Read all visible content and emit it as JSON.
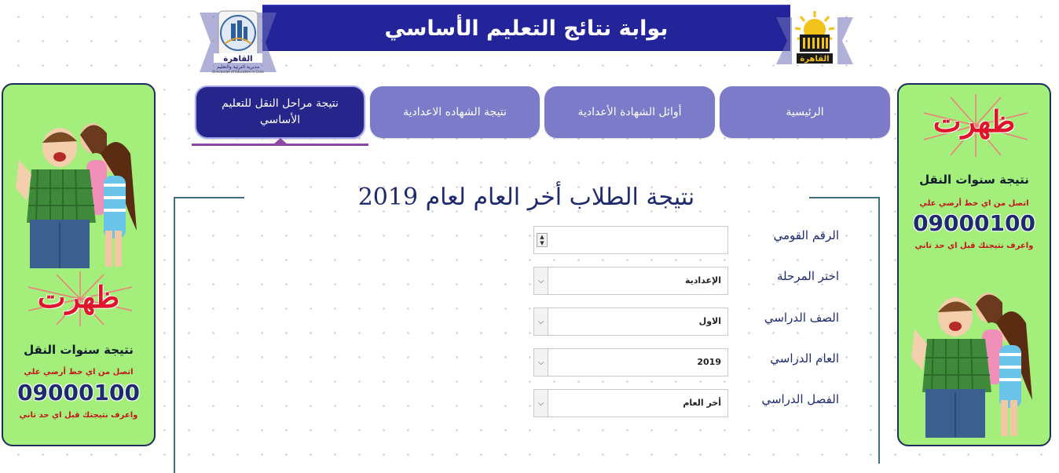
{
  "header": {
    "title": "بوابة نتائج التعليم الأساسي",
    "logo_left_text": "القاهرة",
    "logo_left_subtext": "مديرية التربية والتعليم",
    "logo_left_caption": "Directorate of Education in Cairo",
    "logo_right_text": "القاهرة"
  },
  "nav": {
    "items": [
      {
        "label": "الرئيسية"
      },
      {
        "label": "أوائل الشهادة الأعدادية"
      },
      {
        "label": "نتيجة الشهاده الاعدادية"
      },
      {
        "label": "نتيجة مراحل النقل للتعليم الأساسي"
      }
    ],
    "active_index": 3
  },
  "ads": {
    "headline": "ظهرت",
    "subtitle": "نتيجة سنوات النقل",
    "call_line": "اتصل من اي خط أرضي علي",
    "phone": "09000100",
    "footer_line": "واعرف نتيجتك قبل اي حد تاني"
  },
  "form": {
    "title": "نتيجة الطلاب أخر العام لعام 2019",
    "national_id_label": "الرقم القومي",
    "national_id_value": "",
    "stage_label": "اختر المرحلة",
    "stage_value": "الإعدادية",
    "grade_label": "الصف الدراسي",
    "grade_value": "الاول",
    "year_label": "العام الدراسي",
    "year_value": "2019",
    "term_label": "الفصل الدراسي",
    "term_value": "أخر العام"
  },
  "colors": {
    "header_bg": "#24249a",
    "nav_bg": "#7b7bc9",
    "nav_active_bg": "#25258c",
    "ad_bg": "#a4ee7b",
    "accent_red": "#e0142b",
    "text_navy": "#1e2a6e"
  }
}
